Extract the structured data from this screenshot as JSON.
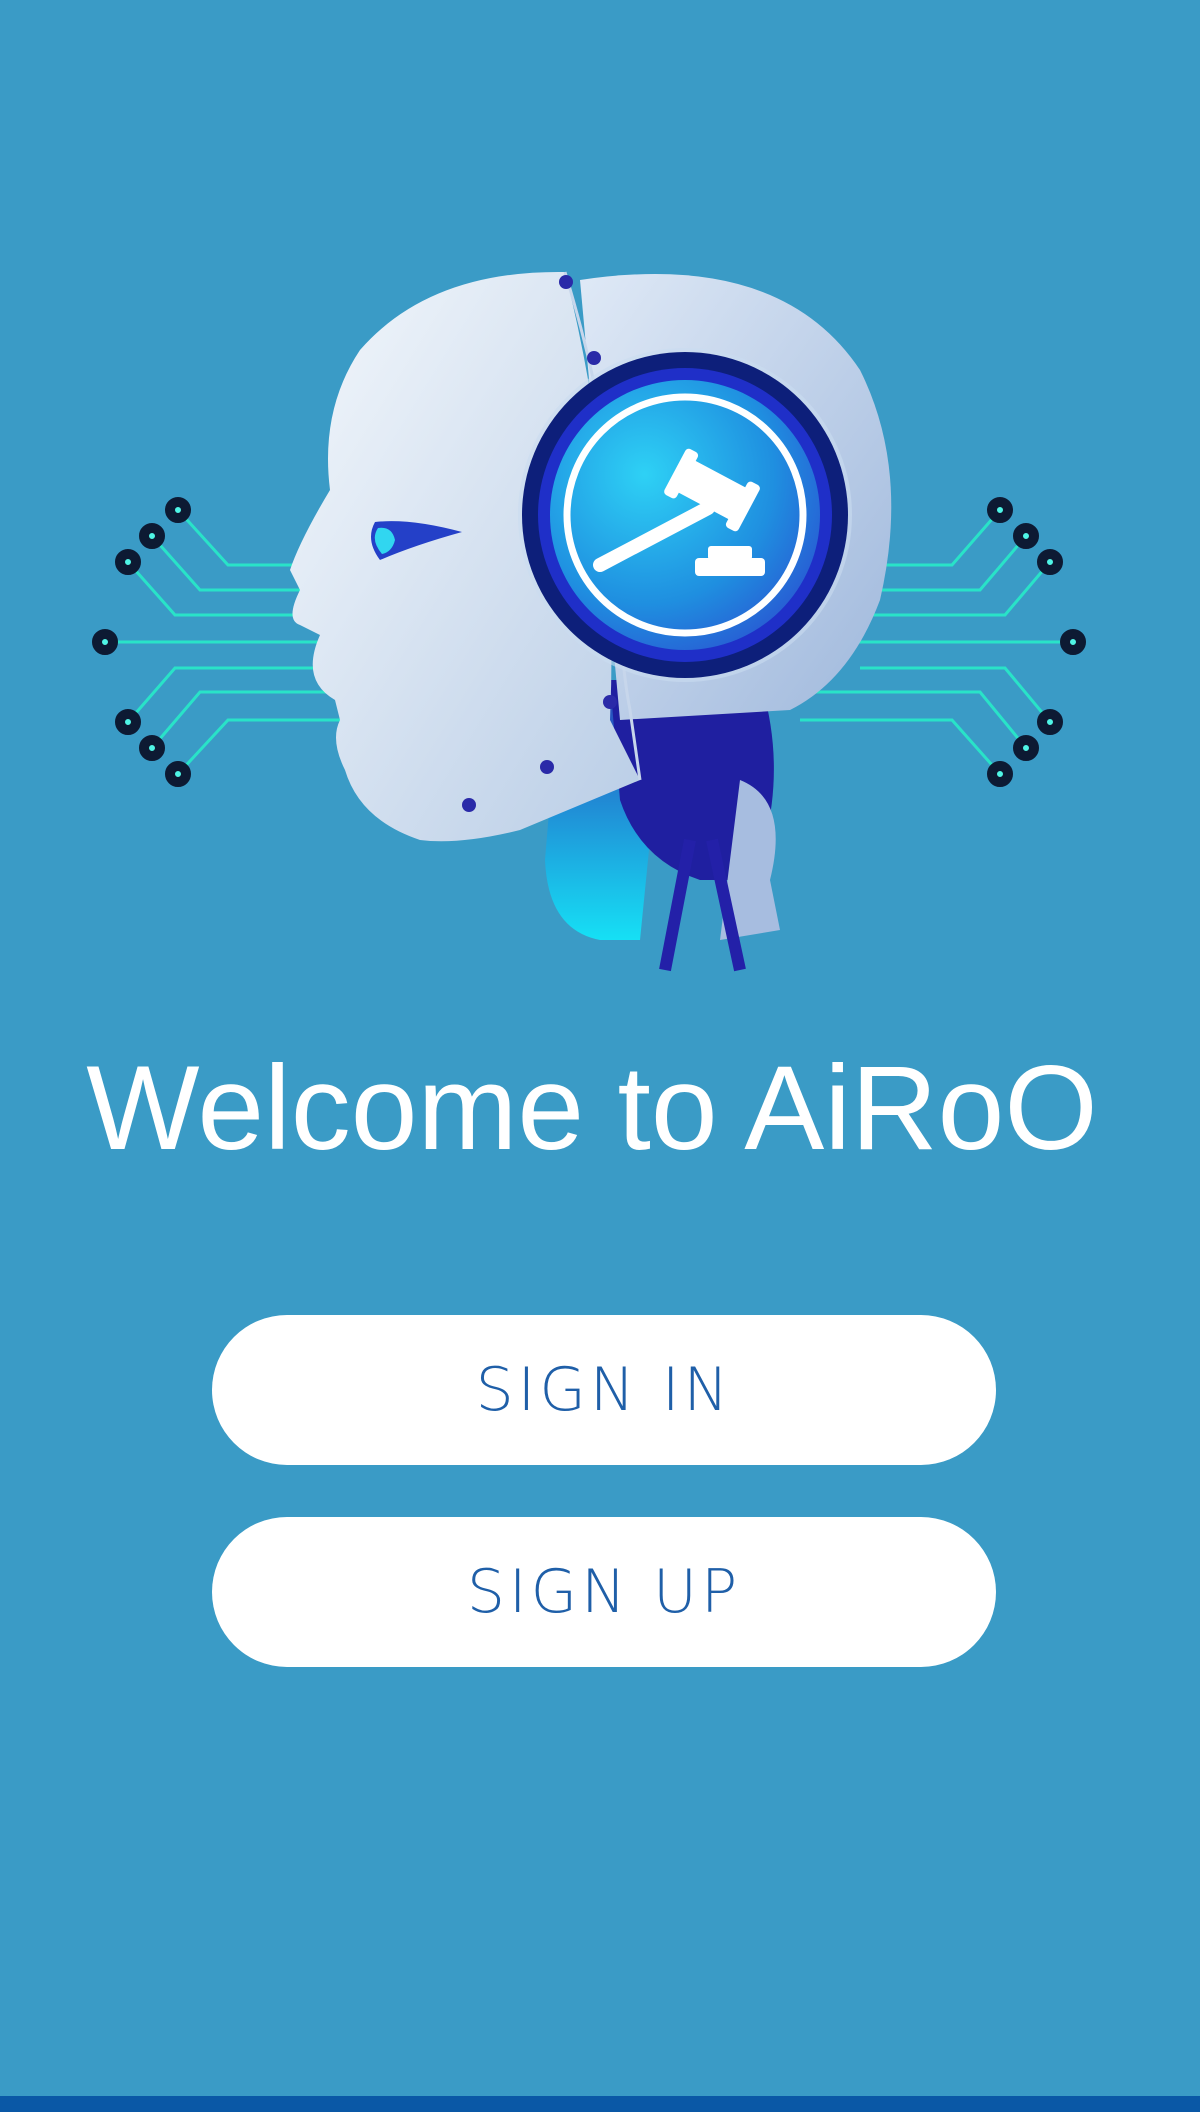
{
  "welcome": {
    "title": "Welcome to AiRoO"
  },
  "actions": {
    "sign_in_label": "SIGN IN",
    "sign_up_label": "SIGN UP"
  },
  "colors": {
    "background": "#3a9bc6",
    "button_background": "#ffffff",
    "button_text": "#1f5fa8",
    "bottom_bar": "#0a58a6"
  },
  "icons": {
    "illustration": "robot-head-with-gavel-icon"
  }
}
